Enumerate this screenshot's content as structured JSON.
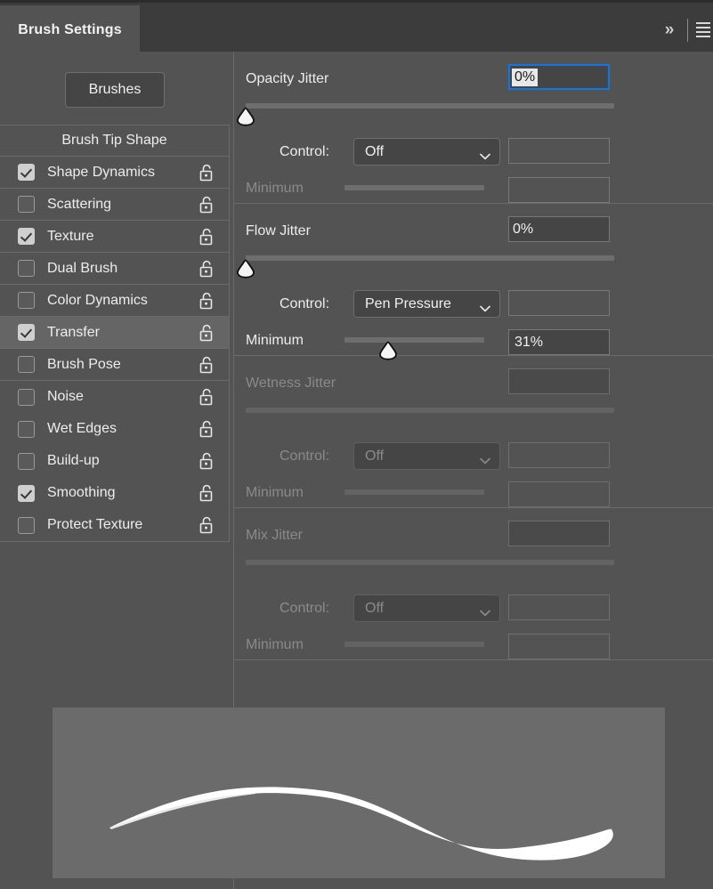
{
  "window": {
    "tab_label": "Brush Settings",
    "collapse_icon": "double-chevron-right-icon",
    "menu_icon": "hamburger-menu-icon"
  },
  "sidebar": {
    "brushes_button": "Brushes",
    "list_header": "Brush Tip Shape",
    "items": [
      {
        "label": "Shape Dynamics",
        "checked": true,
        "selected": false,
        "lock": "unlocked-padlock-icon"
      },
      {
        "label": "Scattering",
        "checked": false,
        "selected": false,
        "lock": "unlocked-padlock-icon"
      },
      {
        "label": "Texture",
        "checked": true,
        "selected": false,
        "lock": "unlocked-padlock-icon"
      },
      {
        "label": "Dual Brush",
        "checked": false,
        "selected": false,
        "lock": "unlocked-padlock-icon"
      },
      {
        "label": "Color Dynamics",
        "checked": false,
        "selected": false,
        "lock": "unlocked-padlock-icon"
      },
      {
        "label": "Transfer",
        "checked": true,
        "selected": true,
        "lock": "unlocked-padlock-icon"
      },
      {
        "label": "Brush Pose",
        "checked": false,
        "selected": false,
        "lock": "unlocked-padlock-icon"
      },
      {
        "label": "Noise",
        "checked": false,
        "selected": false,
        "lock": "unlocked-padlock-icon"
      },
      {
        "label": "Wet Edges",
        "checked": false,
        "selected": false,
        "lock": "unlocked-padlock-icon"
      },
      {
        "label": "Build-up",
        "checked": false,
        "selected": false,
        "lock": "unlocked-padlock-icon"
      },
      {
        "label": "Smoothing",
        "checked": true,
        "selected": false,
        "lock": "unlocked-padlock-icon"
      },
      {
        "label": "Protect Texture",
        "checked": false,
        "selected": false,
        "lock": "unlocked-padlock-icon"
      }
    ]
  },
  "sections": {
    "opacity_jitter": {
      "title": "Opacity Jitter",
      "value": "0%",
      "slider_percent": 0,
      "focused": true,
      "enabled": true,
      "control_label": "Control:",
      "control_value": "Off",
      "control_extra_value": "",
      "minimum_label": "Minimum",
      "minimum_value": "",
      "minimum_percent": 0,
      "minimum_enabled": false
    },
    "flow_jitter": {
      "title": "Flow Jitter",
      "value": "0%",
      "slider_percent": 0,
      "focused": false,
      "enabled": true,
      "control_label": "Control:",
      "control_value": "Pen Pressure",
      "control_extra_value": "",
      "minimum_label": "Minimum",
      "minimum_value": "31%",
      "minimum_percent": 31,
      "minimum_enabled": true
    },
    "wetness_jitter": {
      "title": "Wetness Jitter",
      "value": "",
      "slider_percent": 0,
      "focused": false,
      "enabled": false,
      "control_label": "Control:",
      "control_value": "Off",
      "control_extra_value": "",
      "minimum_label": "Minimum",
      "minimum_value": "",
      "minimum_percent": 0,
      "minimum_enabled": false
    },
    "mix_jitter": {
      "title": "Mix Jitter",
      "value": "",
      "slider_percent": 0,
      "focused": false,
      "enabled": false,
      "control_label": "Control:",
      "control_value": "Off",
      "control_extra_value": "",
      "minimum_label": "Minimum",
      "minimum_value": "",
      "minimum_percent": 0,
      "minimum_enabled": false
    }
  },
  "preview": {
    "name": "brush-stroke-preview",
    "stroke_color": "#ffffff",
    "background_color": "#6b6b6b"
  },
  "colors": {
    "panel_bg": "#535353",
    "titlebar_bg": "#3c3c3c",
    "accent_focus": "#1473e6",
    "field_bg": "#454545",
    "border": "#6b6b6b",
    "text": "#ededed",
    "text_disabled": "#8a8a8a"
  }
}
